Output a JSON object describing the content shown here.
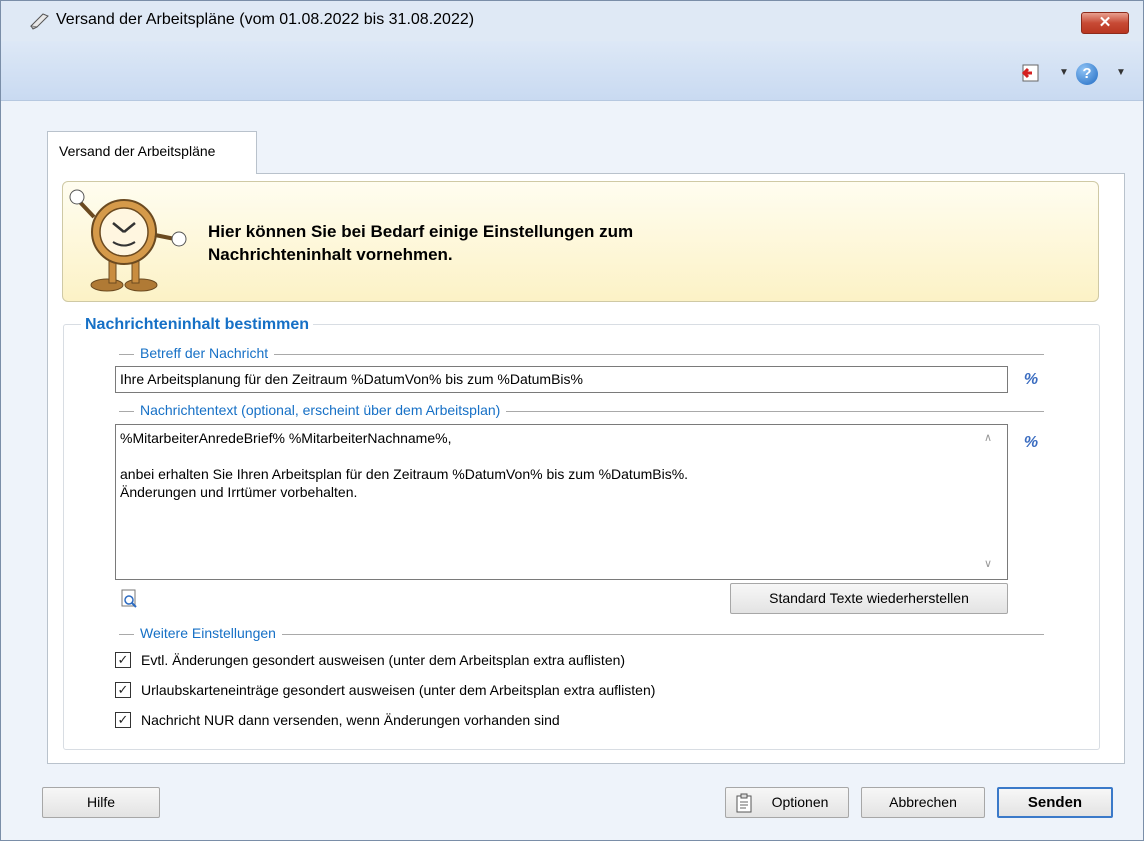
{
  "window": {
    "title": "Versand der Arbeitspläne (vom 01.08.2022 bis 31.08.2022)",
    "close_glyph": "✕"
  },
  "toolbar": {
    "help_glyph": "?",
    "dropdown_glyph": "▼"
  },
  "tab": {
    "label": "Versand der Arbeitspläne"
  },
  "hint": {
    "line1": "Hier können Sie bei Bedarf einige Einstellungen zum",
    "line2": "Nachrichteninhalt vornehmen."
  },
  "group": {
    "title": "Nachrichteninhalt bestimmen",
    "subject_label": "Betreff der Nachricht",
    "subject_value": "Ihre Arbeitsplanung für den Zeitraum %DatumVon% bis zum %DatumBis%",
    "body_label": "Nachrichtentext (optional, erscheint über dem Arbeitsplan)",
    "body_value": "%MitarbeiterAnredeBrief% %MitarbeiterNachname%,\n\nanbei erhalten Sie Ihren Arbeitsplan für den Zeitraum %DatumVon% bis zum %DatumBis%.\nÄnderungen und Irrtümer vorbehalten.",
    "placeholder_glyph": "%",
    "restore_button": "Standard Texte wiederherstellen",
    "settings_label": "Weitere Einstellungen",
    "checkboxes": [
      {
        "label": "Evtl. Änderungen gesondert ausweisen (unter dem Arbeitsplan extra auflisten)",
        "checked": true
      },
      {
        "label": "Urlaubskarteneinträge gesondert ausweisen (unter dem Arbeitsplan extra auflisten)",
        "checked": true
      },
      {
        "label": "Nachricht NUR dann versenden, wenn Änderungen vorhanden sind",
        "checked": true
      }
    ],
    "check_glyph": "✓"
  },
  "footer": {
    "help_button": "Hilfe",
    "options_button": "Optionen",
    "cancel_button": "Abbrechen",
    "send_button": "Senden"
  },
  "colors": {
    "accent": "#1670c6",
    "close": "#c74a35"
  }
}
